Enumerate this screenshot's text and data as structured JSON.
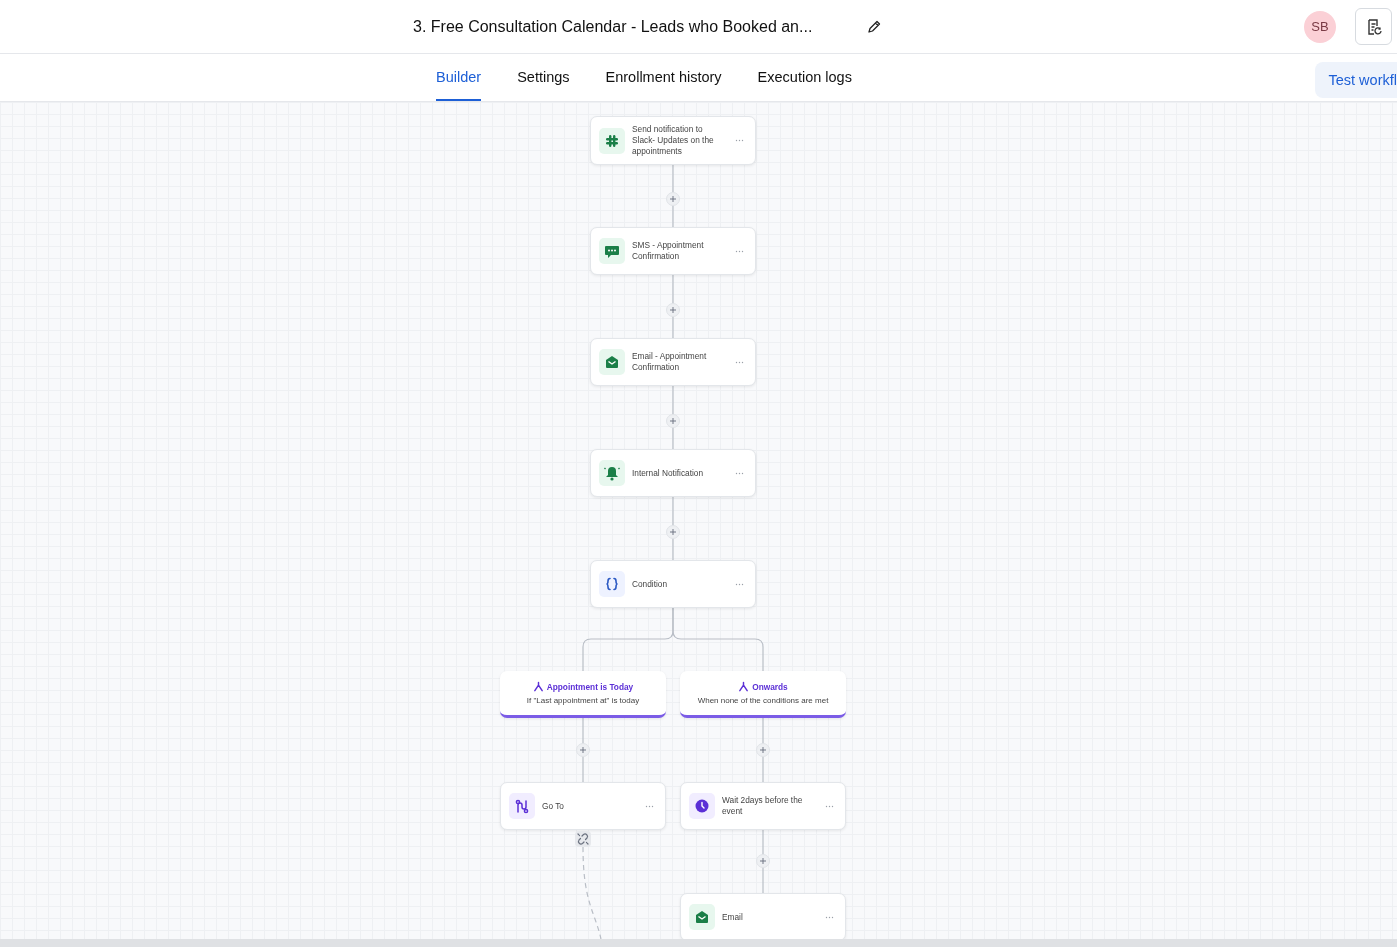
{
  "header": {
    "title": "3. Free Consultation Calendar - Leads who Booked an...",
    "avatar": "SB"
  },
  "tabs": [
    {
      "label": "Builder",
      "selected": true
    },
    {
      "label": "Settings",
      "selected": false
    },
    {
      "label": "Enrollment history",
      "selected": false
    },
    {
      "label": "Execution logs",
      "selected": false
    }
  ],
  "test_button": {
    "label": "Test workfl"
  },
  "workflow": {
    "steps": [
      {
        "kind": "slack",
        "label": "Send notification to Slack- Updates on the appointments"
      },
      {
        "kind": "sms",
        "label": "SMS - Appointment Confirmation"
      },
      {
        "kind": "email",
        "label": "Email - Appointment Confirmation"
      },
      {
        "kind": "notification",
        "label": "Internal Notification"
      },
      {
        "kind": "condition",
        "label": "Condition"
      }
    ],
    "branches": [
      {
        "title": "Appointment is Today",
        "description": "If \"Last appointment at\" is today",
        "steps": [
          {
            "kind": "goto",
            "label": "Go To"
          }
        ]
      },
      {
        "title": "Onwards",
        "description": "When none of the conditions are met",
        "steps": [
          {
            "kind": "wait",
            "label": "Wait 2days before the event"
          },
          {
            "kind": "email",
            "label": "Email"
          }
        ]
      }
    ]
  }
}
